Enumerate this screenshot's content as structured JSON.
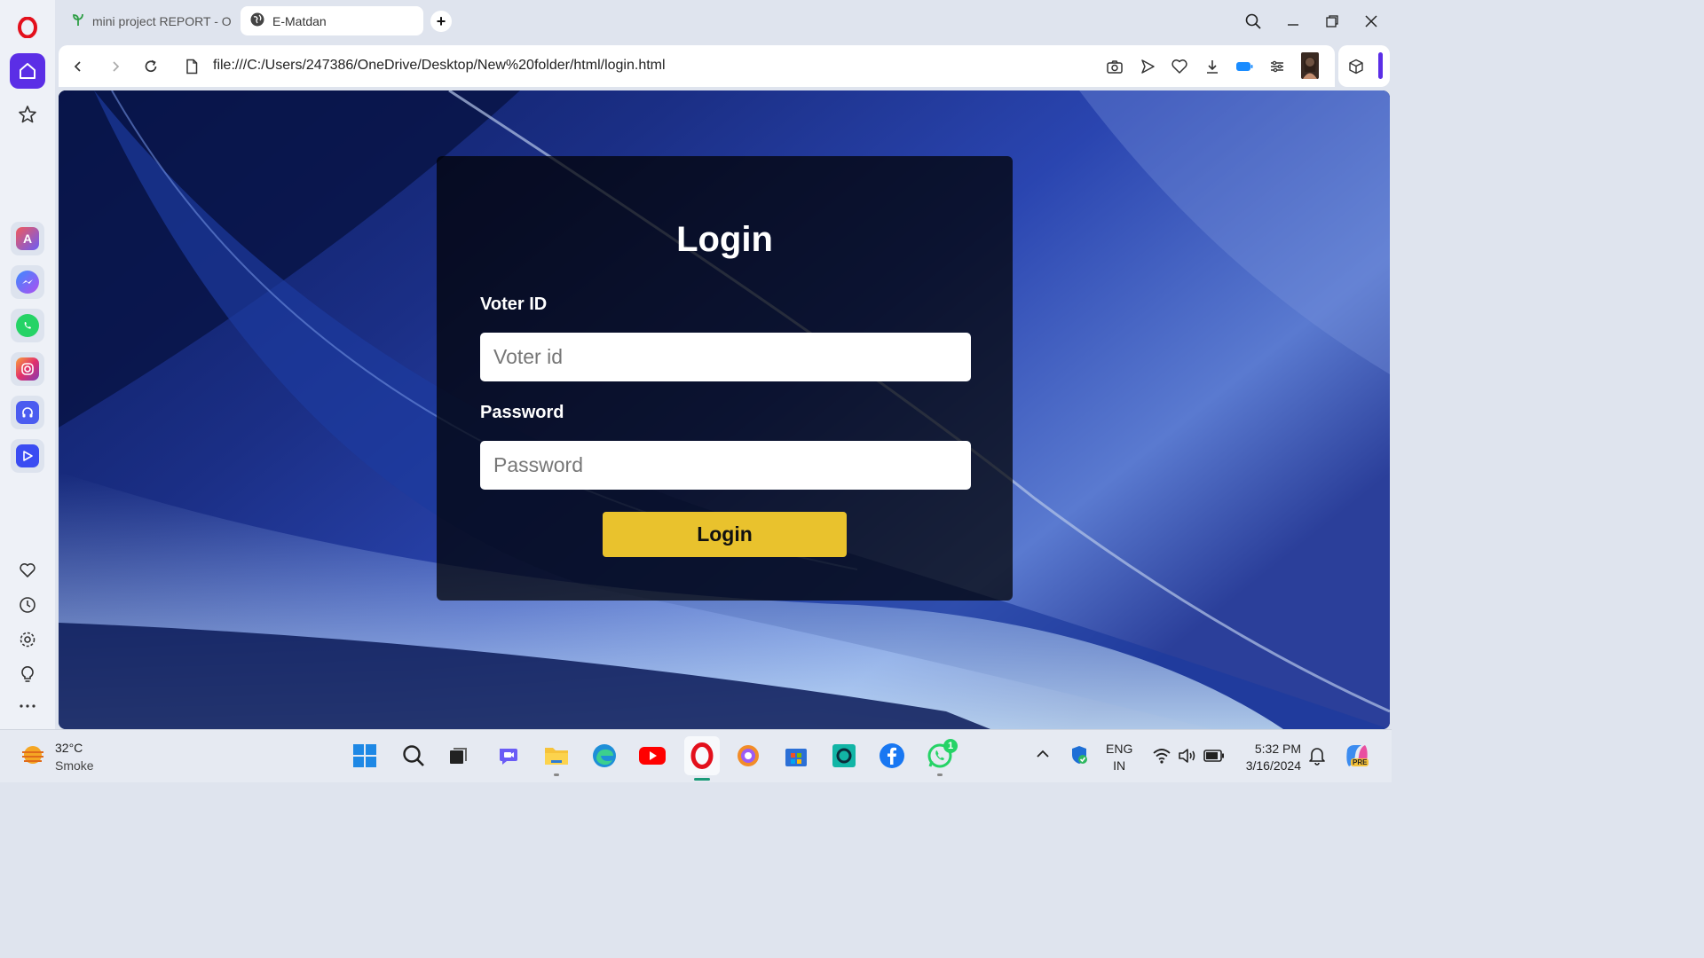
{
  "browser": {
    "tabs": [
      {
        "label": "mini project REPORT - Onl",
        "active": false,
        "icon": "sprout-icon"
      },
      {
        "label": "E-Matdan",
        "active": true,
        "icon": "globe-icon"
      }
    ],
    "url": "file:///C:/Users/247386/OneDrive/Desktop/New%20folder/html/login.html"
  },
  "sidebar": {
    "apps": [
      "aria-icon",
      "messenger-icon",
      "whatsapp-icon",
      "instagram-icon",
      "music-player-icon",
      "player-icon"
    ],
    "bottom": [
      "heart-icon",
      "history-icon",
      "settings-icon",
      "lightbulb-icon",
      "more-icon"
    ]
  },
  "login": {
    "title": "Login",
    "voter_label": "Voter ID",
    "voter_placeholder": "Voter id",
    "password_label": "Password",
    "password_placeholder": "Password",
    "button": "Login"
  },
  "taskbar": {
    "weather_temp": "32°C",
    "weather_desc": "Smoke",
    "lang_line1": "ENG",
    "lang_line2": "IN",
    "time": "5:32 PM",
    "date": "3/16/2024",
    "whatsapp_badge": "1",
    "copilot_badge": "PRE"
  },
  "colors": {
    "accent": "#5b2ee6",
    "login_button": "#e9c22d",
    "opera_red": "#e3101c"
  }
}
